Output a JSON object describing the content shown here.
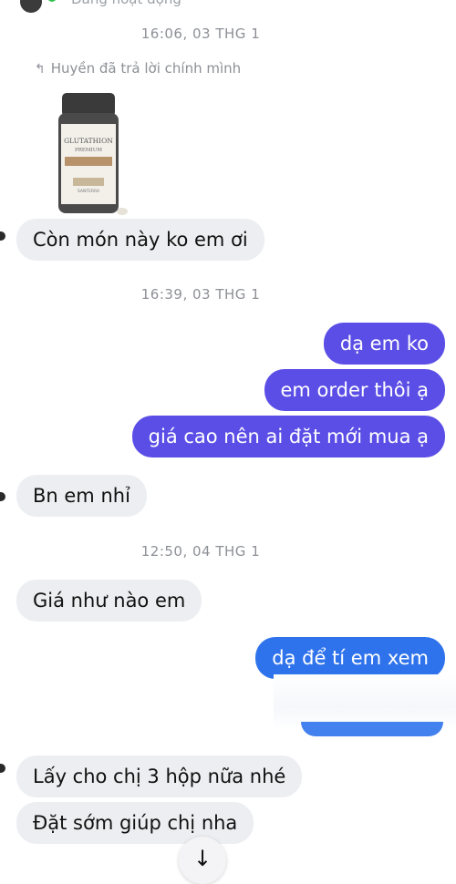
{
  "header": {
    "status_text": "Đang hoạt động"
  },
  "thread": {
    "ts1": "16:06, 03 THG 1",
    "reply_note": "Huyền đã trả lời chính mình",
    "product": {
      "name": "GLUTATHION",
      "sub": "PREMIUM",
      "brand": "SANTERRA"
    },
    "msg1": "Còn món này ko em ơi",
    "ts2": "16:39, 03 THG 1",
    "out1": "dạ em ko",
    "out2": "em order thôi ạ",
    "out3": "giá cao nên ai đặt mới mua ạ",
    "msg2": "Bn em nhỉ",
    "ts3": "12:50, 04 THG 1",
    "msg3": "Giá như nào em",
    "out4": "dạ để tí em xem",
    "msg4": "Lấy cho chị 3 hộp nữa nhé",
    "msg5": "Đặt sớm giúp chị nha"
  },
  "icons": {
    "reply": "reply-arrow-icon",
    "scroll": "arrow-down-icon"
  },
  "colors": {
    "out_bubble": "#5b4ee6",
    "blue_bubble": "#2f73ec",
    "in_bubble": "#eceef1"
  }
}
